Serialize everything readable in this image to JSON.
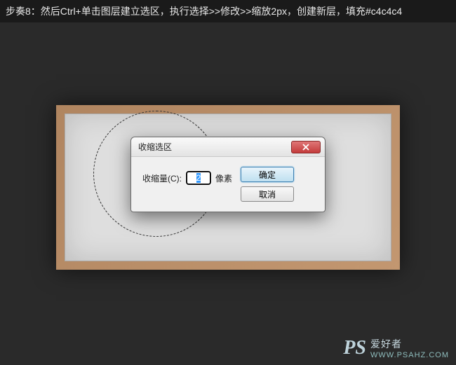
{
  "instruction": "步奏8：然后Ctrl+单击图层建立选区，执行选择>>修改>>缩放2px，创建新层，填充#c4c4c4",
  "dialog": {
    "title": "收缩选区",
    "input_label": "收缩量(C):",
    "input_value": "2",
    "unit": "像素",
    "ok_label": "确定",
    "cancel_label": "取消"
  },
  "watermark": {
    "logo": "PS",
    "text": "爱好者",
    "url": "WWW.PSAHZ.COM"
  },
  "colors": {
    "fill": "#c4c4c4",
    "frame": "#c39770",
    "canvas": "#dedede"
  }
}
